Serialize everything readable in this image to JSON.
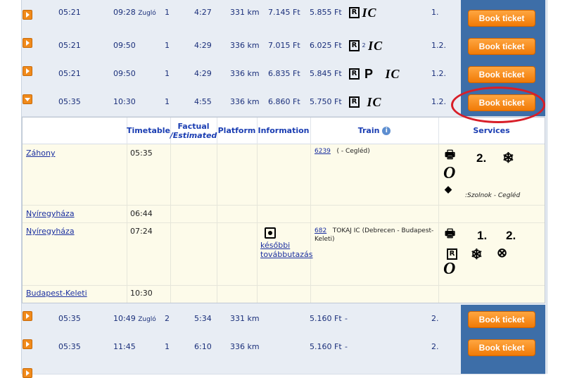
{
  "rows_top": [
    {
      "dep": "05:21",
      "arr": "09:28",
      "arr_note": "Zugló",
      "changes": "1",
      "duration": "4:27",
      "distance": "331 km",
      "price1": "7.145 Ft",
      "price2": "5.855 Ft",
      "train_icons": "R IC",
      "class": "1.",
      "book": "Book ticket",
      "expanded": false
    },
    {
      "dep": "05:21",
      "arr": "09:50",
      "arr_note": "",
      "changes": "1",
      "duration": "4:29",
      "distance": "336 km",
      "price1": "7.015 Ft",
      "price2": "6.025 Ft",
      "train_icons": "R 2 IC",
      "class": "1.2.",
      "book": "Book ticket",
      "expanded": false
    },
    {
      "dep": "05:21",
      "arr": "09:50",
      "arr_note": "",
      "changes": "1",
      "duration": "4:29",
      "distance": "336 km",
      "price1": "6.835 Ft",
      "price2": "5.845 Ft",
      "train_icons": "R P IC",
      "class": "1.2.",
      "book": "Book ticket",
      "expanded": false
    },
    {
      "dep": "05:35",
      "arr": "10:30",
      "arr_note": "",
      "changes": "1",
      "duration": "4:55",
      "distance": "336 km",
      "price1": "6.860 Ft",
      "price2": "5.750 Ft",
      "train_icons": "R IC",
      "class": "1.2.",
      "book": "Book ticket",
      "expanded": true
    }
  ],
  "detail": {
    "headers": {
      "timetable": "Timetable",
      "factual": "Factual",
      "estimated": "/Estimated",
      "platform": "Platform",
      "information": "Information",
      "train": "Train",
      "services": "Services"
    },
    "stops": [
      {
        "name": "Záhony",
        "time": "05:35",
        "train_no": "6239",
        "train_desc": "( - Cegléd)",
        "info": "",
        "services_note": ":Szolnok - Cegléd"
      },
      {
        "name": "Nyíregyháza",
        "time": "06:44"
      },
      {
        "name": "Nyíregyháza",
        "time": "07:24",
        "train_no": "682",
        "train_desc": "TOKAJ IC (Debrecen - Budapest-Keleti)",
        "info": "későbbi továbbutazás"
      },
      {
        "name": "Budapest-Keleti",
        "time": "10:30"
      }
    ],
    "svc": {
      "class2": "2.",
      "class1": "1.",
      "class2b": "2."
    }
  },
  "rows_bottom": [
    {
      "dep": "05:35",
      "arr": "10:49",
      "arr_note": "Zugló",
      "changes": "2",
      "duration": "5:34",
      "distance": "331 km",
      "price1": "",
      "price2": "5.160 Ft",
      "train_icons": "-",
      "class": "2.",
      "book": "Book ticket"
    },
    {
      "dep": "05:35",
      "arr": "11:45",
      "arr_note": "",
      "changes": "1",
      "duration": "6:10",
      "distance": "336 km",
      "price1": "",
      "price2": "5.160 Ft",
      "train_icons": "-",
      "class": "2.",
      "book": "Book ticket"
    }
  ],
  "colors": {
    "accent": "#f08a1b",
    "book_cell": "#3d6ea8",
    "highlight": "#d81e28"
  }
}
